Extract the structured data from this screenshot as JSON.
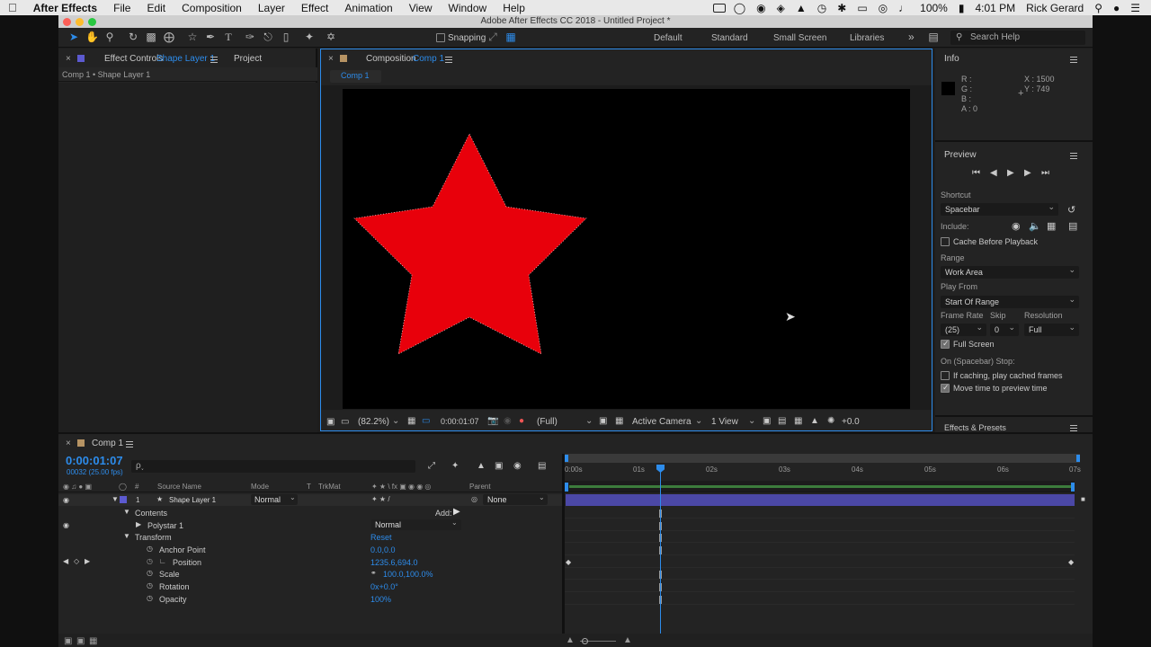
{
  "menubar": {
    "app_name": "After Effects",
    "items": [
      "File",
      "Edit",
      "Composition",
      "Layer",
      "Effect",
      "Animation",
      "View",
      "Window",
      "Help"
    ],
    "battery": "100%",
    "clock": "4:01 PM",
    "user": "Rick Gerard"
  },
  "window": {
    "title": "Adobe After Effects CC 2018 - Untitled Project *"
  },
  "toolbar": {
    "snapping_label": "Snapping",
    "workspaces": [
      "Default",
      "Standard",
      "Small Screen",
      "Libraries"
    ],
    "more": "»",
    "search_placeholder": "Search Help"
  },
  "effect_controls": {
    "tab_prefix": "Effect Controls",
    "tab_layer": "Shape Layer 1",
    "project_tab": "Project",
    "breadcrumb": "Comp 1 • Shape Layer 1"
  },
  "composition": {
    "tab_prefix": "Composition",
    "tab_name": "Comp 1",
    "subtab": "Comp 1",
    "zoom": "(82.2%)",
    "timecode": "0:00:01:07",
    "resolution": "(Full)",
    "camera": "Active Camera",
    "views": "1 View",
    "exposure": "+0.0",
    "shape_color": "#e8000b"
  },
  "info": {
    "title": "Info",
    "r": "R :",
    "g": "G :",
    "b": "B :",
    "a": "A : 0",
    "x": "X : 1500",
    "y": "Y : 749"
  },
  "preview": {
    "title": "Preview",
    "shortcut_label": "Shortcut",
    "shortcut_value": "Spacebar",
    "include_label": "Include:",
    "cache_before": "Cache Before Playback",
    "range_label": "Range",
    "range_value": "Work Area",
    "play_from_label": "Play From",
    "play_from_value": "Start Of Range",
    "frame_rate_label": "Frame Rate",
    "skip_label": "Skip",
    "resolution_label": "Resolution",
    "frame_rate_value": "(25)",
    "skip_value": "0",
    "resolution_value": "Full",
    "full_screen": "Full Screen",
    "stop_label": "On (Spacebar) Stop:",
    "if_caching": "If caching, play cached frames",
    "move_time": "Move time to preview time",
    "effects_presets": "Effects & Presets",
    "full_screen_checked": true,
    "move_time_checked": true
  },
  "timeline": {
    "tab": "Comp 1",
    "timecode": "0:00:01:07",
    "frame_info": "00032 (25.00 fps)",
    "search_placeholder": "ρ˯",
    "col_source": "Source Name",
    "col_mode": "Mode",
    "col_t": "T",
    "col_trkmat": "TrkMat",
    "col_parent": "Parent",
    "col_num": "#",
    "layer_num": "1",
    "layer_name": "Shape Layer 1",
    "layer_mode": "Normal",
    "parent_value": "None",
    "contents": "Contents",
    "add_label": "Add:",
    "polystar": "Polystar 1",
    "polystar_mode": "Normal",
    "transform": "Transform",
    "reset": "Reset",
    "props": [
      {
        "name": "Anchor Point",
        "value": "0.0,0.0"
      },
      {
        "name": "Position",
        "value": "1235.6,694.0"
      },
      {
        "name": "Scale",
        "value": "100.0,100.0%"
      },
      {
        "name": "Rotation",
        "value": "0x+0.0°"
      },
      {
        "name": "Opacity",
        "value": "100%"
      }
    ],
    "ruler": [
      "0:00s",
      "01s",
      "02s",
      "03s",
      "04s",
      "05s",
      "06s",
      "07s"
    ],
    "label_color": "#5c5ad0"
  }
}
